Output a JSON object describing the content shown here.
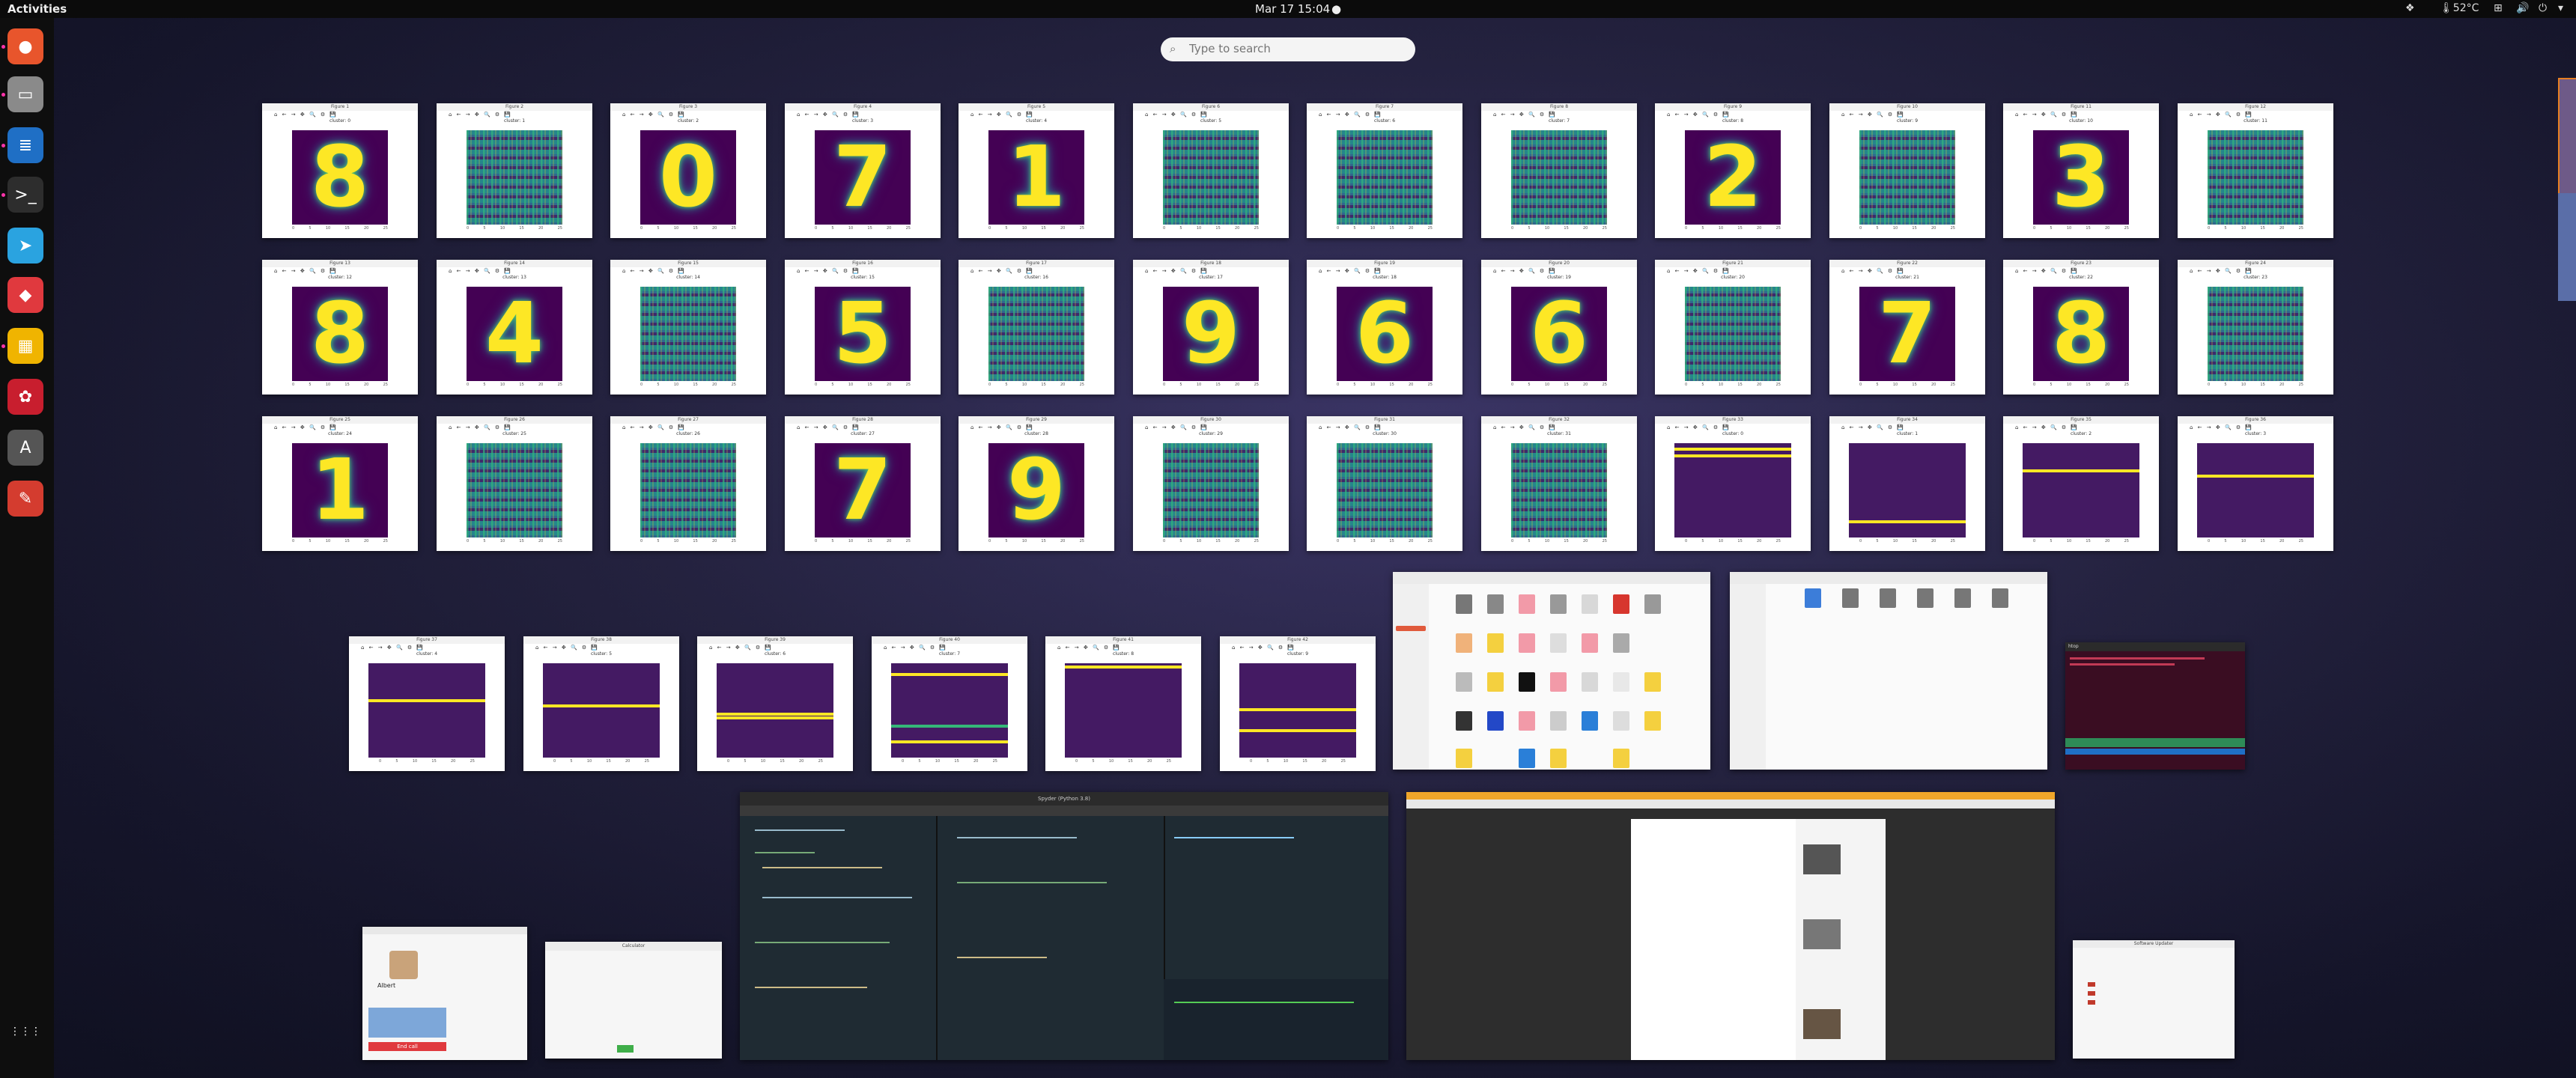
{
  "topbar": {
    "activities": "Activities",
    "clock": "Mar 17  15:04",
    "temperature": "52°C"
  },
  "search": {
    "placeholder": "Type to search"
  },
  "dock": {
    "apps": [
      {
        "name": "firefox-icon",
        "color": "#e8552c",
        "glyph": "●"
      },
      {
        "name": "files-icon",
        "color": "#8a8a8a",
        "glyph": "▭"
      },
      {
        "name": "writer-icon",
        "color": "#1f6fc5",
        "glyph": "≣"
      },
      {
        "name": "terminal-icon",
        "color": "#2d2d2d",
        "glyph": ">_"
      },
      {
        "name": "telegram-icon",
        "color": "#2aa3e0",
        "glyph": "➤"
      },
      {
        "name": "anydesk-icon",
        "color": "#e0393e",
        "glyph": "◆"
      },
      {
        "name": "calculator-icon",
        "color": "#f0b400",
        "glyph": "▦"
      },
      {
        "name": "xmind-icon",
        "color": "#c81e2e",
        "glyph": "✿"
      },
      {
        "name": "software-center-icon",
        "color": "#555555",
        "glyph": "A"
      },
      {
        "name": "inkscape-icon",
        "color": "#d43c2f",
        "glyph": "✎"
      },
      {
        "name": "show-apps-icon",
        "color": "transparent",
        "glyph": "⋮⋮⋮"
      }
    ]
  },
  "figures": {
    "tools": "⌂ ← → ✥ 🔍 ⚙ 💾",
    "xticks": [
      "0",
      "5",
      "10",
      "15",
      "20",
      "25"
    ],
    "items": [
      {
        "title": "Figure 1",
        "subtitle": "cluster: 0",
        "kind": "digit",
        "digit": "8"
      },
      {
        "title": "Figure 2",
        "subtitle": "cluster: 1",
        "kind": "noise"
      },
      {
        "title": "Figure 3",
        "subtitle": "cluster: 2",
        "kind": "digit",
        "digit": "0"
      },
      {
        "title": "Figure 4",
        "subtitle": "cluster: 3",
        "kind": "digit",
        "digit": "7"
      },
      {
        "title": "Figure 5",
        "subtitle": "cluster: 4",
        "kind": "digit",
        "digit": "1"
      },
      {
        "title": "Figure 6",
        "subtitle": "cluster: 5",
        "kind": "noise"
      },
      {
        "title": "Figure 7",
        "subtitle": "cluster: 6",
        "kind": "noise"
      },
      {
        "title": "Figure 8",
        "subtitle": "cluster: 7",
        "kind": "noise"
      },
      {
        "title": "Figure 9",
        "subtitle": "cluster: 8",
        "kind": "digit",
        "digit": "2"
      },
      {
        "title": "Figure 10",
        "subtitle": "cluster: 9",
        "kind": "noise"
      },
      {
        "title": "Figure 11",
        "subtitle": "cluster: 10",
        "kind": "digit",
        "digit": "3"
      },
      {
        "title": "Figure 12",
        "subtitle": "cluster: 11",
        "kind": "noise"
      },
      {
        "title": "Figure 13",
        "subtitle": "cluster: 12",
        "kind": "digit",
        "digit": "8"
      },
      {
        "title": "Figure 14",
        "subtitle": "cluster: 13",
        "kind": "digit",
        "digit": "4"
      },
      {
        "title": "Figure 15",
        "subtitle": "cluster: 14",
        "kind": "noise"
      },
      {
        "title": "Figure 16",
        "subtitle": "cluster: 15",
        "kind": "digit",
        "digit": "5"
      },
      {
        "title": "Figure 17",
        "subtitle": "cluster: 16",
        "kind": "noise"
      },
      {
        "title": "Figure 18",
        "subtitle": "cluster: 17",
        "kind": "digit",
        "digit": "9"
      },
      {
        "title": "Figure 19",
        "subtitle": "cluster: 18",
        "kind": "digit",
        "digit": "6"
      },
      {
        "title": "Figure 20",
        "subtitle": "cluster: 19",
        "kind": "digit",
        "digit": "6"
      },
      {
        "title": "Figure 21",
        "subtitle": "cluster: 20",
        "kind": "noise"
      },
      {
        "title": "Figure 22",
        "subtitle": "cluster: 21",
        "kind": "digit",
        "digit": "7"
      },
      {
        "title": "Figure 23",
        "subtitle": "cluster: 22",
        "kind": "digit",
        "digit": "8"
      },
      {
        "title": "Figure 24",
        "subtitle": "cluster: 23",
        "kind": "noise"
      },
      {
        "title": "Figure 25",
        "subtitle": "cluster: 24",
        "kind": "digit",
        "digit": "1"
      },
      {
        "title": "Figure 26",
        "subtitle": "cluster: 25",
        "kind": "noise"
      },
      {
        "title": "Figure 27",
        "subtitle": "cluster: 26",
        "kind": "noise"
      },
      {
        "title": "Figure 28",
        "subtitle": "cluster: 27",
        "kind": "digit",
        "digit": "7"
      },
      {
        "title": "Figure 29",
        "subtitle": "cluster: 28",
        "kind": "digit",
        "digit": "9"
      },
      {
        "title": "Figure 30",
        "subtitle": "cluster: 29",
        "kind": "noise"
      },
      {
        "title": "Figure 31",
        "subtitle": "cluster: 30",
        "kind": "noise"
      },
      {
        "title": "Figure 32",
        "subtitle": "cluster: 31",
        "kind": "noise"
      },
      {
        "title": "Figure 33",
        "subtitle": "cluster: 0",
        "kind": "stripe",
        "bands": [
          0.05,
          0.12
        ]
      },
      {
        "title": "Figure 34",
        "subtitle": "cluster: 1",
        "kind": "stripe",
        "bands": [
          0.82
        ]
      },
      {
        "title": "Figure 35",
        "subtitle": "cluster: 2",
        "kind": "stripe",
        "bands": [
          0.28
        ]
      },
      {
        "title": "Figure 36",
        "subtitle": "cluster: 3",
        "kind": "stripe",
        "bands": [
          0.33
        ]
      },
      {
        "title": "Figure 37",
        "subtitle": "cluster: 4",
        "kind": "stripe",
        "bands": [
          0.38
        ]
      },
      {
        "title": "Figure 38",
        "subtitle": "cluster: 5",
        "kind": "stripe",
        "bands": [
          0.44
        ]
      },
      {
        "title": "Figure 39",
        "subtitle": "cluster: 6",
        "kind": "stripe",
        "bands": [
          0.52,
          0.56
        ]
      },
      {
        "title": "Figure 40",
        "subtitle": "cluster: 7",
        "kind": "stripe",
        "bands": [
          0.1,
          0.65,
          0.82
        ],
        "green": [
          1
        ]
      },
      {
        "title": "Figure 41",
        "subtitle": "cluster: 8",
        "kind": "stripe",
        "bands": [
          0.02
        ]
      },
      {
        "title": "Figure 42",
        "subtitle": "cluster: 9",
        "kind": "stripe",
        "bands": [
          0.48,
          0.7
        ]
      }
    ]
  },
  "windows": {
    "ide_title": "Spyder (Python 3.8)",
    "terminal_title": "htop",
    "calculator_title": "Calculator",
    "dialog_title": "Software Updater",
    "profile_name": "Albert",
    "end_call_label": "End call"
  }
}
